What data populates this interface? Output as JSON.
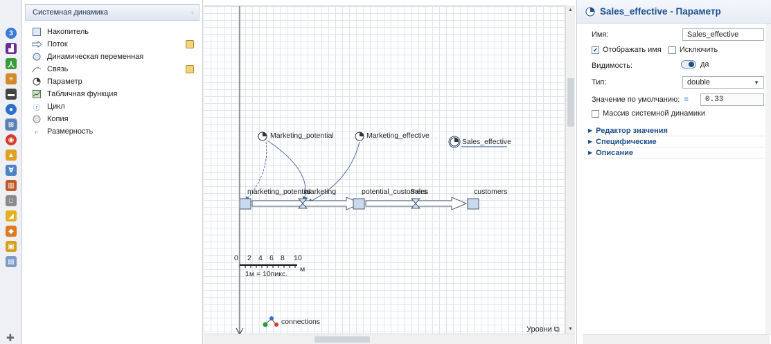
{
  "palette": {
    "header": "Системная динамика",
    "items": [
      {
        "label": "Накопитель",
        "icon": "stock-icon"
      },
      {
        "label": "Поток",
        "icon": "flow-icon"
      },
      {
        "label": "Динамическая переменная",
        "icon": "dynamic-variable-icon"
      },
      {
        "label": "Связь",
        "icon": "link-icon"
      },
      {
        "label": "Параметр",
        "icon": "parameter-icon"
      },
      {
        "label": "Табличная функция",
        "icon": "table-function-icon"
      },
      {
        "label": "Цикл",
        "icon": "loop-icon"
      },
      {
        "label": "Копия",
        "icon": "shadow-icon"
      },
      {
        "label": "Размерность",
        "icon": "dimension-icon"
      }
    ]
  },
  "canvas": {
    "params": {
      "marketing_potential": "Marketing_potential",
      "marketing_effective": "Marketing_effective",
      "sales_effective": "Sales_effective"
    },
    "stocks": {
      "s1": "marketing_potential",
      "s2": "potential_customers",
      "s3": "customers"
    },
    "flows": {
      "f1": "marketing",
      "f2": "Sales"
    },
    "scale": {
      "ticks": [
        "0",
        "2",
        "4",
        "6",
        "8",
        "10"
      ],
      "unit": "м",
      "ratio": "1м = 10пикс."
    },
    "connections": "connections",
    "levels": "Уровни"
  },
  "properties": {
    "title": "Sales_effective - Параметр",
    "name_label": "Имя:",
    "name_value": "Sales_effective",
    "show_name_label": "Отображать имя",
    "show_name_checked": true,
    "exclude_label": "Исключить",
    "visibility_label": "Видимость:",
    "visibility_value": "да",
    "type_label": "Тип:",
    "type_value": "double",
    "default_label": "Значение по умолчанию:",
    "default_value": "0.33",
    "array_label": "Массив системной динамики",
    "sections": [
      "Редактор значения",
      "Специфические",
      "Описание"
    ]
  },
  "colors": {
    "accent": "#1f4e8c",
    "link": "#4a6fa0"
  }
}
